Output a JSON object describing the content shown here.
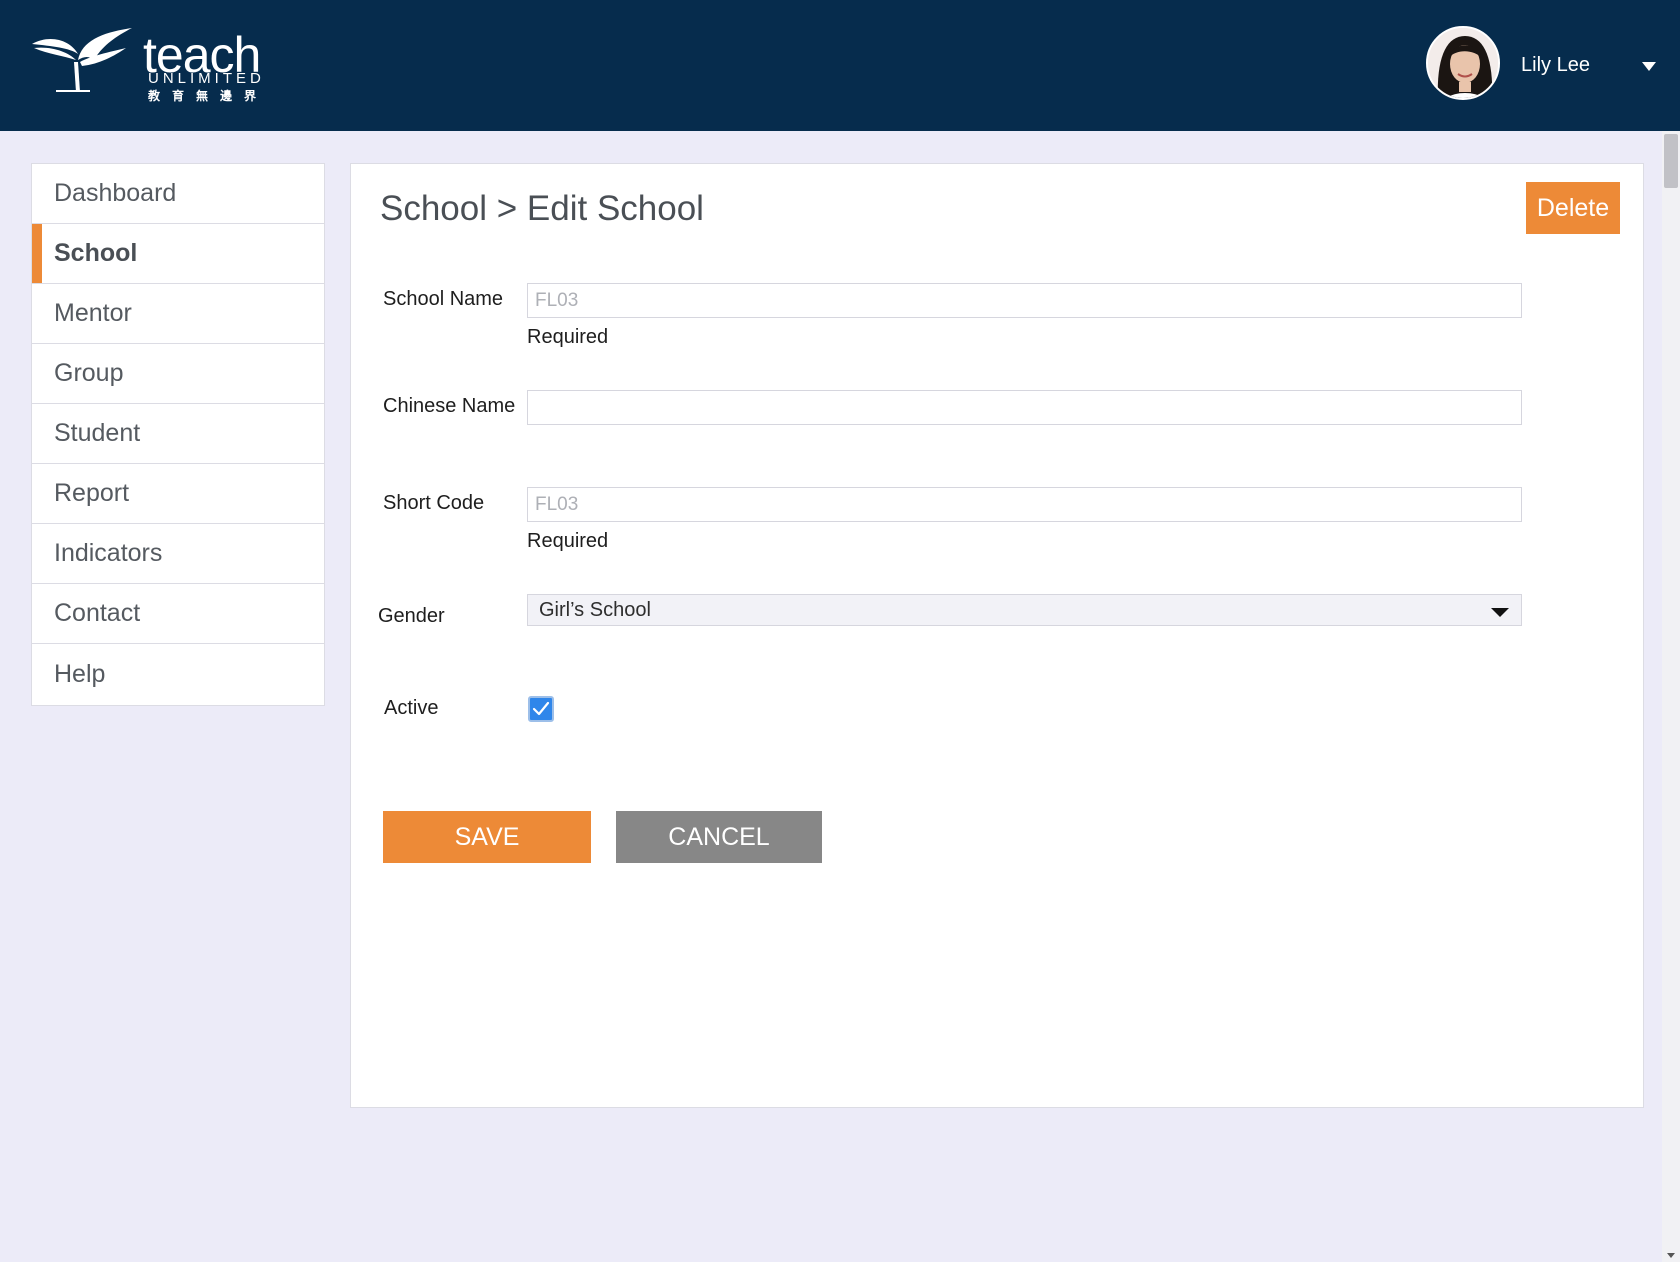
{
  "header": {
    "logo": {
      "word": "teach",
      "sub": "UNLIMITED",
      "chinese": "教育無邊界"
    },
    "user": {
      "name": "Lily Lee"
    }
  },
  "sidebar": {
    "items": [
      {
        "label": "Dashboard",
        "active": false
      },
      {
        "label": "School",
        "active": true
      },
      {
        "label": "Mentor",
        "active": false
      },
      {
        "label": "Group",
        "active": false
      },
      {
        "label": "Student",
        "active": false
      },
      {
        "label": "Report",
        "active": false
      },
      {
        "label": "Indicators",
        "active": false
      },
      {
        "label": "Contact",
        "active": false
      },
      {
        "label": "Help",
        "active": false
      }
    ]
  },
  "main": {
    "title": "School > Edit School",
    "delete_label": "Delete",
    "form": {
      "school_name": {
        "label": "School Name",
        "value": "",
        "placeholder": "FL03",
        "hint": "Required"
      },
      "chinese_name": {
        "label": "Chinese Name",
        "value": "",
        "placeholder": ""
      },
      "short_code": {
        "label": "Short Code",
        "value": "",
        "placeholder": "FL03",
        "hint": "Required"
      },
      "gender": {
        "label": "Gender",
        "selected": "Girl’s School"
      },
      "active": {
        "label": "Active",
        "checked": true
      }
    },
    "save_label": "SAVE",
    "cancel_label": "CANCEL"
  },
  "colors": {
    "header_bg": "#062c4d",
    "accent": "#ed8a37",
    "cancel_bg": "#878787",
    "page_bg": "#ecebf8",
    "checkbox": "#2f86ea"
  }
}
